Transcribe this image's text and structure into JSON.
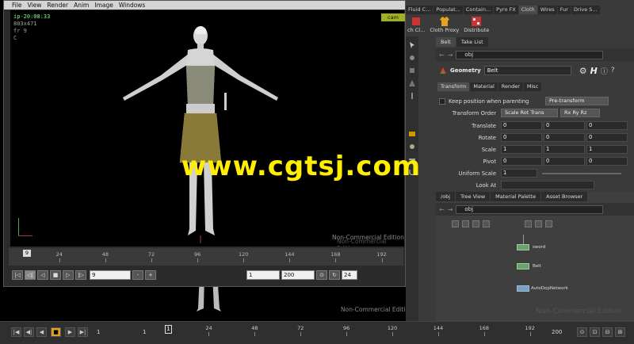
{
  "flipbook": {
    "menu": [
      "File",
      "View",
      "Render",
      "Anim",
      "Image",
      "Windows"
    ],
    "info": [
      "ip-20:08:33",
      "803x471",
      "fr 9",
      "C"
    ],
    "cam_label": "cam",
    "nce_1": "Non-Commercial Edition",
    "nce_2": "Non-Commercial Edition",
    "ticks": [
      "24",
      "48",
      "72",
      "96",
      "120",
      "144",
      "168",
      "192"
    ],
    "current_marker": "9",
    "frame_field": "9",
    "start_field": "1",
    "end_field": "200",
    "fps_field": "24"
  },
  "main_timeline": {
    "start_field": "1",
    "current_field": "1",
    "ticks": [
      "24",
      "48",
      "72",
      "96",
      "120",
      "144",
      "168",
      "192"
    ],
    "marker": "1",
    "end_value": "200",
    "nce": "Non-Commercial Edition"
  },
  "shelf": {
    "tabs": [
      "Fluid C...",
      "Populat...",
      "Contain...",
      "Pyro FX",
      "Cloth",
      "Wires",
      "Fur",
      "Drive S..."
    ],
    "tools": [
      "ch Cl...",
      "Cloth Proxy",
      "Distribute"
    ]
  },
  "param_pane": {
    "tabs": [
      "Belt",
      "Take List"
    ],
    "path": "obj",
    "node_type": "Geometry",
    "node_name": "Belt",
    "subtabs": [
      "Transform",
      "Material",
      "Render",
      "Misc"
    ],
    "keep_pos_label": "Keep position when parenting",
    "keep_pos_value": "Pre-transform",
    "transform_order_label": "Transform Order",
    "transform_order_value": "Scale Rot Trans",
    "rot_order_value": "Rx Ry Rz",
    "translate_label": "Translate",
    "translate": [
      "0",
      "0",
      "0"
    ],
    "rotate_label": "Rotate",
    "rotate": [
      "0",
      "0",
      "0"
    ],
    "scale_label": "Scale",
    "scale": [
      "1",
      "1",
      "1"
    ],
    "pivot_label": "Pivot",
    "pivot": [
      "0",
      "0",
      "0"
    ],
    "uniform_scale_label": "Uniform Scale",
    "uniform_scale": "1",
    "look_at_label": "Look At"
  },
  "network_pane": {
    "tabs": [
      "/obj",
      "Tree View",
      "Material Palette",
      "Asset Browser"
    ],
    "path": "obj",
    "nodes": [
      "sword",
      "Belt",
      "AutoDopNetwork"
    ],
    "nce": "Non-Commercial Edition"
  },
  "watermark": "www.cgtsj.com"
}
